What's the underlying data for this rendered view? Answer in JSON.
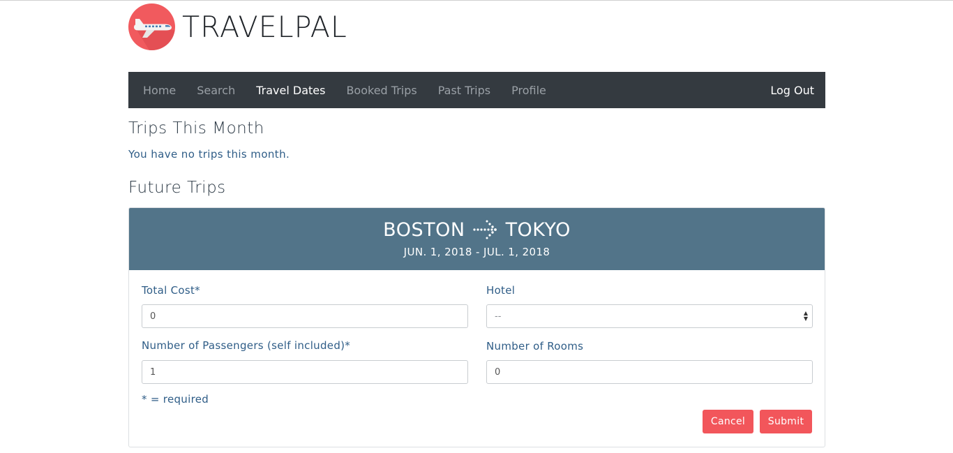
{
  "brand": {
    "name": "TRAVELPAL",
    "logo_icon": "airplane-icon",
    "accent": "#f15a5e"
  },
  "nav": {
    "items": [
      {
        "label": "Home",
        "active": false
      },
      {
        "label": "Search",
        "active": false
      },
      {
        "label": "Travel Dates",
        "active": true
      },
      {
        "label": "Booked Trips",
        "active": false
      },
      {
        "label": "Past Trips",
        "active": false
      },
      {
        "label": "Profile",
        "active": false
      }
    ],
    "logout": "Log Out",
    "background": "#343a40"
  },
  "this_month": {
    "title": "Trips This Month",
    "empty_message": "You have no trips this month."
  },
  "future": {
    "title": "Future Trips",
    "trip": {
      "origin": "BOSTON",
      "destination": "TOKYO",
      "arrow_icon": "dotted-arrow-right-icon",
      "dates": "JUN. 1, 2018 - JUL. 1, 2018",
      "header_color": "#527489",
      "form": {
        "total_cost_label": "Total Cost*",
        "total_cost_value": "0",
        "hotel_label": "Hotel",
        "hotel_value": "--",
        "passengers_label": "Number of Passengers (self included)*",
        "passengers_value": "1",
        "rooms_label": "Number of Rooms",
        "rooms_value": "0",
        "required_note": "* = required",
        "cancel": "Cancel",
        "submit": "Submit",
        "button_color": "#f2565b"
      }
    }
  }
}
